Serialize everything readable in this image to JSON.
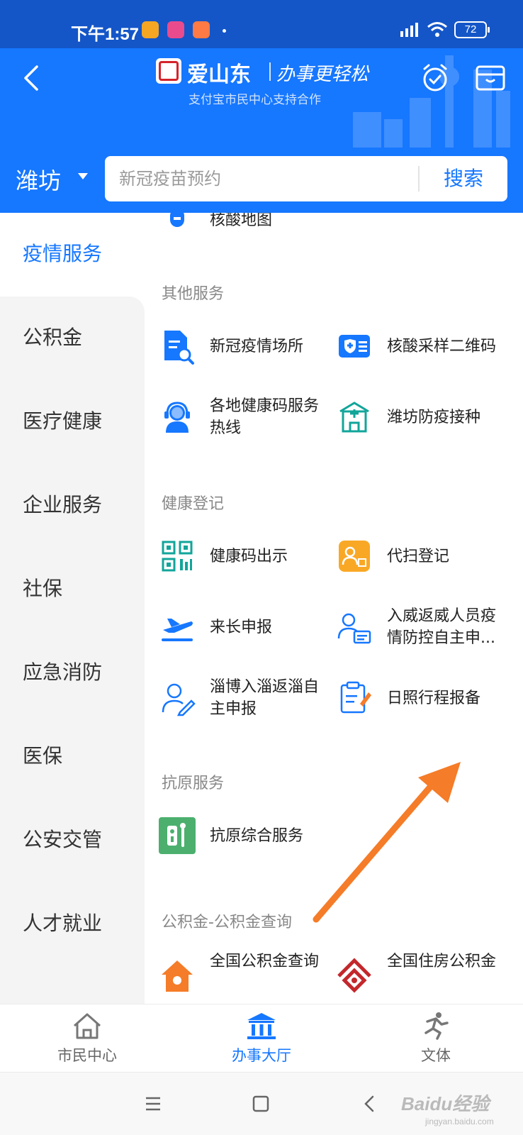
{
  "status_bar": {
    "time": "下午1:57",
    "battery": "72"
  },
  "header": {
    "logo_title": "爱山东",
    "logo_slogan": "办事更轻松",
    "logo_subtitle": "支付宝市民中心支持合作",
    "icons": [
      "back-arrow-icon",
      "alarm-check-icon",
      "wallet-icon"
    ]
  },
  "search": {
    "city": "潍坊",
    "placeholder": "新冠疫苗预约",
    "button_label": "搜索"
  },
  "sidebar": {
    "items": [
      {
        "label": "疫情服务",
        "active": true
      },
      {
        "label": "公积金"
      },
      {
        "label": "医疗健康"
      },
      {
        "label": "企业服务"
      },
      {
        "label": "社保"
      },
      {
        "label": "应急消防"
      },
      {
        "label": "医保"
      },
      {
        "label": "公安交管"
      },
      {
        "label": "人才就业"
      }
    ]
  },
  "content": {
    "partial_item": "核酸地图",
    "sections": [
      {
        "title": "其他服务",
        "items": [
          {
            "label": "新冠疫情场所",
            "icon": "document-search-icon"
          },
          {
            "label": "核酸采样二维码",
            "icon": "medical-card-icon"
          },
          {
            "label": "各地健康码服务热线",
            "icon": "customer-service-icon"
          },
          {
            "label": "潍坊防疫接种",
            "icon": "hospital-icon"
          }
        ]
      },
      {
        "title": "健康登记",
        "items": [
          {
            "label": "健康码出示",
            "icon": "qr-code-icon"
          },
          {
            "label": "代扫登记",
            "icon": "person-scan-icon"
          },
          {
            "label": "来长申报",
            "icon": "airplane-icon"
          },
          {
            "label": "入威返威人员疫情防控自主申...",
            "icon": "person-card-icon"
          },
          {
            "label": "淄博入淄返淄自主申报",
            "icon": "person-edit-icon"
          },
          {
            "label": "日照行程报备",
            "icon": "clipboard-edit-icon"
          }
        ]
      },
      {
        "title": "抗原服务",
        "items": [
          {
            "label": "抗原综合服务",
            "icon": "antigen-test-icon"
          }
        ]
      },
      {
        "title": "公积金-公积金查询",
        "items": [
          {
            "label": "全国公积金查询",
            "icon": "house-icon"
          },
          {
            "label": "全国住房公积金",
            "icon": "national-housing-icon"
          }
        ]
      }
    ]
  },
  "tabbar": {
    "tabs": [
      {
        "label": "市民中心",
        "icon": "home-icon"
      },
      {
        "label": "办事大厅",
        "icon": "government-hall-icon",
        "active": true
      },
      {
        "label": "文体",
        "icon": "running-person-icon"
      }
    ]
  },
  "navbar": {
    "watermark": "Baidu经验",
    "watermark_sub": "jingyan.baidu.com"
  },
  "colors": {
    "primary": "#1677ff",
    "statusbar": "#1456c8",
    "annotation_arrow": "#f57c28",
    "sidebar_bg": "#f4f4f4"
  }
}
